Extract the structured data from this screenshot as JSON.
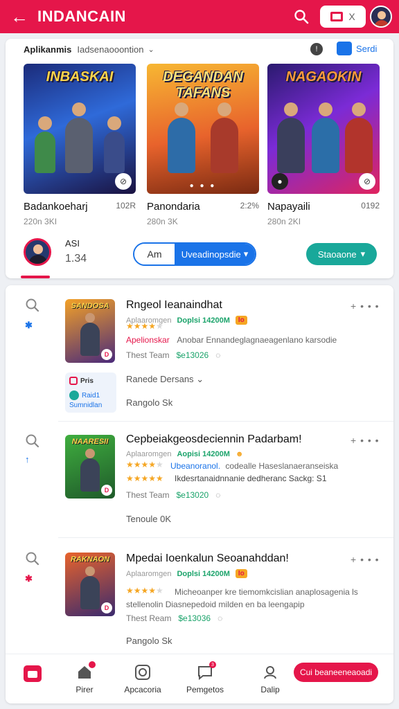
{
  "header": {
    "title": "INDANCAIN",
    "close_label": "X"
  },
  "featured": {
    "heading": "Aplikanmis",
    "filter": "Iadsenaooontion",
    "action_label": "Serdi",
    "games": [
      {
        "title": "INBASKAI",
        "name": "Badankoeharj",
        "size": "102R",
        "count": "220n 3KI"
      },
      {
        "title": "DEGANDAN TAFANS",
        "name": "Panondaria",
        "size": "2:2%",
        "count": "280n 3K"
      },
      {
        "title": "NAGAOKIN",
        "name": "Napayaili",
        "size": "0192",
        "count": "280n 2KI"
      }
    ],
    "user": {
      "name": "ASI",
      "value": "1.34"
    },
    "segment_a": "Am",
    "segment_b": "Uveadinopsdie",
    "teal_button": "Staoaone"
  },
  "list": [
    {
      "mark": "✱",
      "mark_color": "#1a73e8",
      "thumb_title": "SANDOSA",
      "title": "Rngeol Ieanaindhat",
      "meta_label": "Aplaaromgen",
      "meta_value": "Doplsi 14200M",
      "tag": "Io",
      "desc_accent": "Apelionskar",
      "desc": "Anobar Ennandeglagnaeagenlano karsodie",
      "stat_label": "Thest Team",
      "stat_value": "$e13026",
      "mini_1": "Pris",
      "mini_2": "Raid1",
      "mini_3": "Sumnidlan",
      "sub_1": "Ranede  Dersans",
      "sub_2": "Rangolo  Sk"
    },
    {
      "mark": "↑",
      "mark_color": "#1a73e8",
      "thumb_title": "NAARESII",
      "title": "Cepbeiakgeosdeciennin Padarbam!",
      "meta_label": "Aplaaromgen",
      "meta_value": "Aopisi 14200M",
      "tag": "",
      "desc_accent": "Ubeanoranol.",
      "desc": "codealle Haseslanaeranseiska",
      "desc2": "Ikdesrtanaidnnanie dedheranc Sackg:   S1",
      "stat_label": "Thest Team",
      "stat_value": "$e13020",
      "sub_2": "Tenoule  0K"
    },
    {
      "mark": "✱",
      "mark_color": "#e5164a",
      "thumb_title": "RAKNAON",
      "title": "Mpedai Ioenkalun Seoanahddan!",
      "meta_label": "Aplaaromgen",
      "meta_value": "Doplsi 14200M",
      "tag": "Io",
      "desc": "Micheoanper kre tiemomkcislian anaplosagenia ls",
      "desc2": "stellenolin Diasnepedoid milden en ba leengapip",
      "stat_label": "Thest Ream",
      "stat_value": "$e13036",
      "sub_2": "Pangolo  Sk"
    }
  ],
  "nav": {
    "items": [
      "Pirer",
      "Apcacoria",
      "Pemgetos",
      "Dalip"
    ],
    "badge": "3",
    "cta": "Cui beaneeneaoadi"
  }
}
